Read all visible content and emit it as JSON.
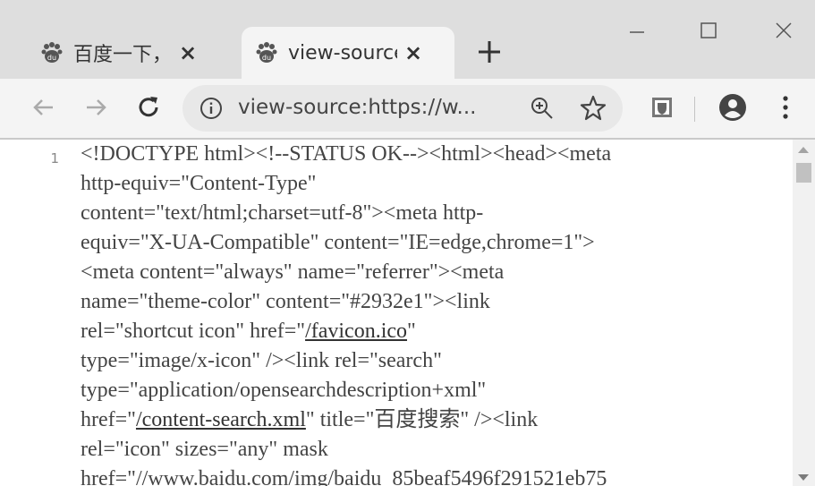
{
  "tabs": [
    {
      "title": "百度一下，你",
      "close": "×",
      "icon": "baidu-paw-icon"
    },
    {
      "title": "view-source",
      "close": "×",
      "icon": "baidu-paw-icon",
      "active": true
    }
  ],
  "new_tab": "+",
  "window_controls": [
    "minimize",
    "maximize",
    "close"
  ],
  "toolbar": {
    "back": "back-arrow-icon",
    "forward": "forward-arrow-icon",
    "reload": "reload-icon",
    "url": "view-source:https://w...",
    "zoom": "zoom-in-icon",
    "bookmark": "star-icon",
    "extension": "shield-extension-icon",
    "profile": "account-icon",
    "menu": "kebab-menu-icon"
  },
  "source": {
    "line_number": "1",
    "lines": [
      [
        {
          "t": "<!DOCTYPE html><!--STATUS OK--><html><head><meta"
        }
      ],
      [
        {
          "t": "http-equiv=\"Content-Type\""
        }
      ],
      [
        {
          "t": "content=\"text/html;charset=utf-8\"><meta http-"
        }
      ],
      [
        {
          "t": "equiv=\"X-UA-Compatible\" content=\"IE=edge,chrome=1\">"
        }
      ],
      [
        {
          "t": "<meta content=\"always\" name=\"referrer\"><meta"
        }
      ],
      [
        {
          "t": "name=\"theme-color\" content=\"#2932e1\"><link"
        }
      ],
      [
        {
          "t": "rel=\"shortcut icon\" href=\""
        },
        {
          "t": "/favicon.ico",
          "link": true
        },
        {
          "t": "\""
        }
      ],
      [
        {
          "t": "type=\"image/x-icon\" /><link rel=\"search\""
        }
      ],
      [
        {
          "t": "type=\"application/opensearchdescription+xml\""
        }
      ],
      [
        {
          "t": "href=\""
        },
        {
          "t": "/content-search.xml",
          "link": true
        },
        {
          "t": "\" title=\"百度搜索\" /><link"
        }
      ],
      [
        {
          "t": "rel=\"icon\" sizes=\"any\" mask"
        }
      ],
      [
        {
          "t": "href=\"//www.baidu.com/img/baidu_85beaf5496f291521eb75"
        }
      ]
    ]
  },
  "colors": {
    "tabbar": "#dedede",
    "toolbar": "#f4f4f4",
    "omnibox": "#e8e8e8",
    "text": "#444444"
  }
}
